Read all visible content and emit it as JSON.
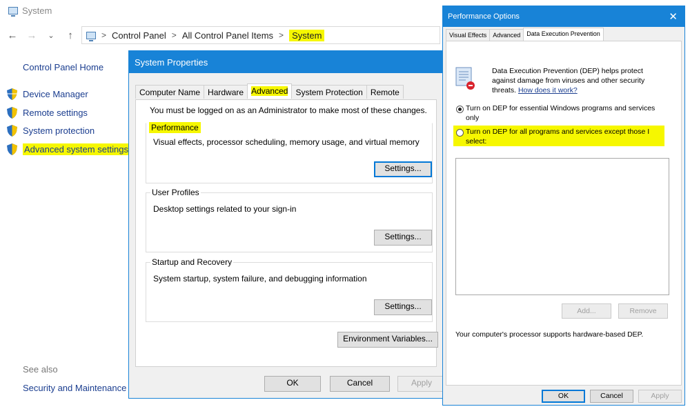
{
  "control_panel": {
    "window_title": "System",
    "nav": {
      "back": "←",
      "forward": "→",
      "down": "⌄",
      "up": "↑"
    },
    "breadcrumb": [
      "Control Panel",
      "All Control Panel Items",
      "System"
    ],
    "home_link": "Control Panel Home",
    "links": [
      "Device Manager",
      "Remote settings",
      "System protection",
      "Advanced system settings"
    ],
    "see_also": "See also",
    "see_also_link": "Security and Maintenance"
  },
  "system_properties": {
    "title": "System Properties",
    "tabs": [
      "Computer Name",
      "Hardware",
      "Advanced",
      "System Protection",
      "Remote"
    ],
    "active_tab": "Advanced",
    "admin_note": "You must be logged on as an Administrator to make most of these changes.",
    "performance": {
      "title": "Performance",
      "desc": "Visual effects, processor scheduling, memory usage, and virtual memory",
      "button": "Settings..."
    },
    "user_profiles": {
      "title": "User Profiles",
      "desc": "Desktop settings related to your sign-in",
      "button": "Settings..."
    },
    "startup_recovery": {
      "title": "Startup and Recovery",
      "desc": "System startup, system failure, and debugging information",
      "button": "Settings..."
    },
    "env_button": "Environment Variables...",
    "ok": "OK",
    "cancel": "Cancel",
    "apply": "Apply"
  },
  "performance_options": {
    "title": "Performance Options",
    "close": "✕",
    "tabs": [
      "Visual Effects",
      "Advanced",
      "Data Execution Prevention"
    ],
    "active_tab": "Data Execution Prevention",
    "dep_desc": "Data Execution Prevention (DEP) helps protect against damage from viruses and other security threats.",
    "dep_link": "How does it work?",
    "option_essential": "Turn on DEP for essential Windows programs and services only",
    "option_all": "Turn on DEP for all programs and services except those I select:",
    "add_button": "Add...",
    "remove_button": "Remove",
    "support_note": "Your computer's processor supports hardware-based DEP.",
    "ok": "OK",
    "cancel": "Cancel",
    "apply": "Apply"
  },
  "colors": {
    "accent": "#1883d7",
    "highlight": "#f6f700",
    "link": "#1a3d8f"
  }
}
